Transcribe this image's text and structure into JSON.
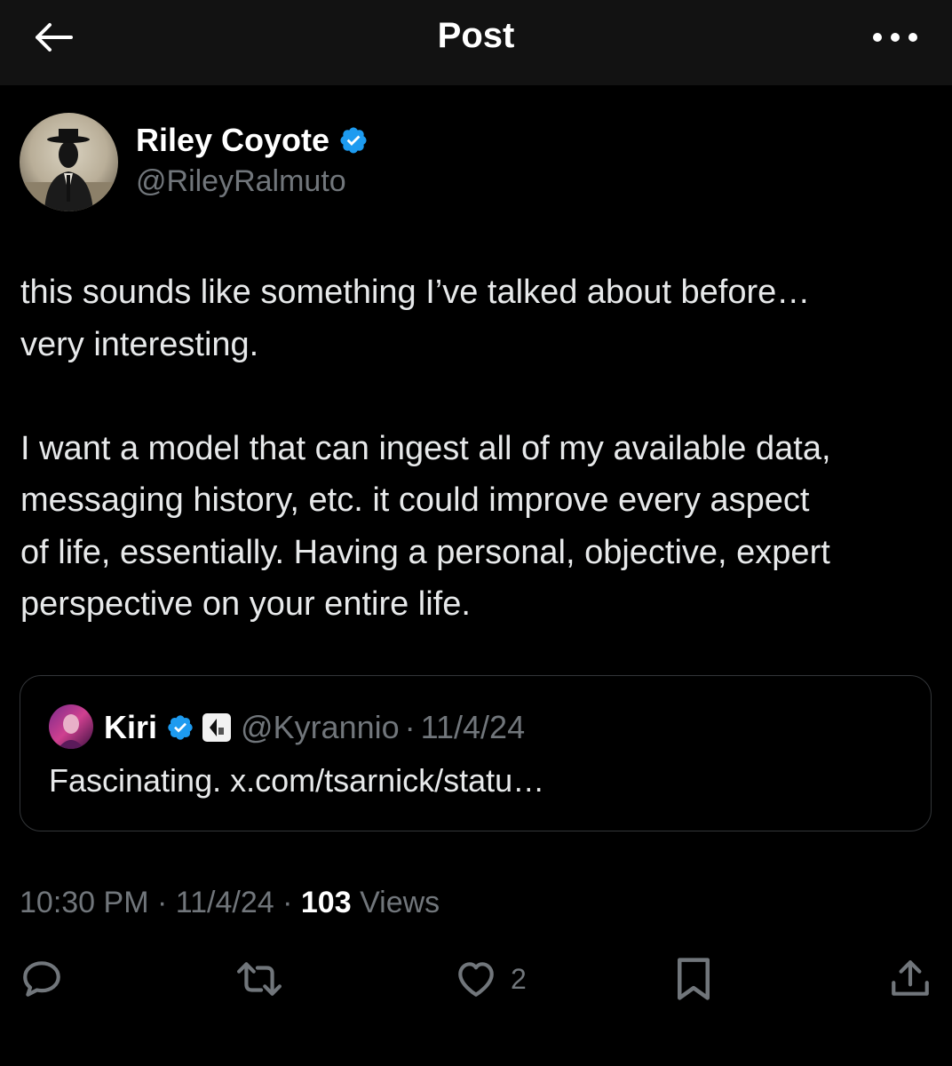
{
  "header": {
    "title": "Post"
  },
  "author": {
    "name": "Riley Coyote",
    "handle": "@RileyRalmuto",
    "verified": true
  },
  "post": {
    "paragraph1": [
      "this sounds like something I’ve talked about before…",
      "very interesting."
    ],
    "paragraph2": [
      "I want a model that can ingest all of my available data,",
      "messaging history, etc. it could improve every aspect",
      "of life, essentially. Having a personal, objective, expert",
      "perspective on your entire life."
    ]
  },
  "quote": {
    "name": "Kiri",
    "handle": "@Kyrannio",
    "separator": "·",
    "date": "11/4/24",
    "text": "Fascinating. x.com/tsarnick/statu…"
  },
  "meta": {
    "time": "10:30 PM",
    "sep": " · ",
    "date": "11/4/24",
    "views_count": "103",
    "views_label": "Views"
  },
  "actions": {
    "reply_count": "",
    "repost_count": "",
    "like_count": "2"
  },
  "colors": {
    "background": "#000000",
    "header_bg": "#121212",
    "text": "#e7e9ea",
    "muted": "#71767b",
    "verified": "#1d9bf0",
    "border": "#333639"
  }
}
